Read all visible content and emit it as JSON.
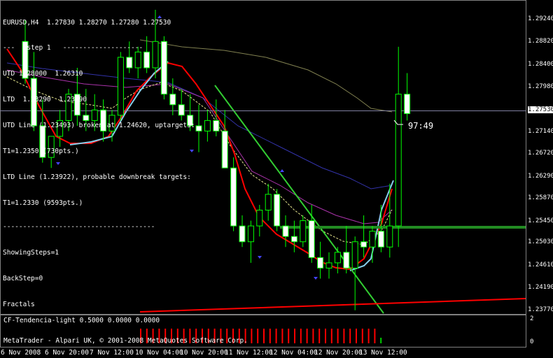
{
  "header": {
    "symbol_line": "EURUSD,H4  1.27830 1.28270 1.27280 1.27530",
    "info_lines": [
      "---   step 1   --------------------",
      "UTD 1.28000  1.26310",
      "LTD  1.23290  1.23890",
      "UTD Line (1.23493) broken at 1.24620, uptargets:",
      "T1=1.2350 (730pts.)",
      "LTD Line (1.23922), probable downbreak targets:",
      "T1=1.2330 (9593pts.)",
      "--------------------------------------",
      "ShowingSteps=1",
      "BackStep=0",
      "Fractals"
    ]
  },
  "timer": "97:49",
  "indicator": {
    "title": "CF-Tendencia-light 0.5000 0.0000 0.0000",
    "scale": [
      "2",
      "0"
    ]
  },
  "footer": {
    "copyright": "MetaTrader - Alpari UK, © 2001-2008 MetaQuotes Software Corp."
  },
  "price_axis": {
    "labels": [
      "1.29240",
      "1.28820",
      "1.28400",
      "1.27980",
      "1.27530",
      "1.27140",
      "1.26720",
      "1.26290",
      "1.25870",
      "1.25450",
      "1.25030",
      "1.24610",
      "1.24190",
      "1.23770"
    ],
    "current": "1.27530"
  },
  "time_axis": [
    "6 Nov 2008",
    "6 Nov 20:00",
    "7 Nov 12:00",
    "10 Nov 04:00",
    "10 Nov 20:00",
    "11 Nov 12:00",
    "12 Nov 04:00",
    "12 Nov 20:00",
    "13 Nov 12:00"
  ],
  "colors": {
    "bull": "#00ff00",
    "bear": "#00ff00",
    "bull_body": "#000000",
    "bear_body": "#ffffff",
    "red_line": "#ff0000",
    "light_blue": "#87ceeb",
    "trend_green": "#32cd32",
    "indicator_bar": "#ff0000"
  },
  "chart_data": {
    "type": "candlestick",
    "price_range": [
      1.2377,
      1.2966
    ],
    "candles": [
      {
        "o": 1.289,
        "h": 1.293,
        "l": 1.281,
        "c": 1.282
      },
      {
        "o": 1.282,
        "h": 1.287,
        "l": 1.272,
        "c": 1.273
      },
      {
        "o": 1.273,
        "h": 1.278,
        "l": 1.266,
        "c": 1.267
      },
      {
        "o": 1.267,
        "h": 1.271,
        "l": 1.265,
        "c": 1.271
      },
      {
        "o": 1.271,
        "h": 1.276,
        "l": 1.269,
        "c": 1.274
      },
      {
        "o": 1.274,
        "h": 1.28,
        "l": 1.272,
        "c": 1.279
      },
      {
        "o": 1.279,
        "h": 1.284,
        "l": 1.273,
        "c": 1.275
      },
      {
        "o": 1.275,
        "h": 1.28,
        "l": 1.272,
        "c": 1.274
      },
      {
        "o": 1.274,
        "h": 1.279,
        "l": 1.272,
        "c": 1.276
      },
      {
        "o": 1.276,
        "h": 1.278,
        "l": 1.27,
        "c": 1.272
      },
      {
        "o": 1.272,
        "h": 1.276,
        "l": 1.27,
        "c": 1.275
      },
      {
        "o": 1.275,
        "h": 1.287,
        "l": 1.274,
        "c": 1.286
      },
      {
        "o": 1.286,
        "h": 1.289,
        "l": 1.283,
        "c": 1.284
      },
      {
        "o": 1.284,
        "h": 1.288,
        "l": 1.282,
        "c": 1.287
      },
      {
        "o": 1.287,
        "h": 1.29,
        "l": 1.283,
        "c": 1.284
      },
      {
        "o": 1.284,
        "h": 1.295,
        "l": 1.282,
        "c": 1.289
      },
      {
        "o": 1.289,
        "h": 1.29,
        "l": 1.278,
        "c": 1.279
      },
      {
        "o": 1.279,
        "h": 1.282,
        "l": 1.275,
        "c": 1.277
      },
      {
        "o": 1.277,
        "h": 1.28,
        "l": 1.274,
        "c": 1.275
      },
      {
        "o": 1.275,
        "h": 1.279,
        "l": 1.272,
        "c": 1.273
      },
      {
        "o": 1.273,
        "h": 1.277,
        "l": 1.268,
        "c": 1.272
      },
      {
        "o": 1.272,
        "h": 1.276,
        "l": 1.27,
        "c": 1.274
      },
      {
        "o": 1.274,
        "h": 1.278,
        "l": 1.271,
        "c": 1.272
      },
      {
        "o": 1.272,
        "h": 1.276,
        "l": 1.265,
        "c": 1.265
      },
      {
        "o": 1.265,
        "h": 1.267,
        "l": 1.253,
        "c": 1.254
      },
      {
        "o": 1.254,
        "h": 1.256,
        "l": 1.25,
        "c": 1.251
      },
      {
        "o": 1.251,
        "h": 1.255,
        "l": 1.247,
        "c": 1.254
      },
      {
        "o": 1.254,
        "h": 1.258,
        "l": 1.252,
        "c": 1.257
      },
      {
        "o": 1.257,
        "h": 1.262,
        "l": 1.255,
        "c": 1.26
      },
      {
        "o": 1.26,
        "h": 1.261,
        "l": 1.253,
        "c": 1.254
      },
      {
        "o": 1.254,
        "h": 1.256,
        "l": 1.25,
        "c": 1.252
      },
      {
        "o": 1.252,
        "h": 1.255,
        "l": 1.249,
        "c": 1.251
      },
      {
        "o": 1.251,
        "h": 1.256,
        "l": 1.25,
        "c": 1.255
      },
      {
        "o": 1.255,
        "h": 1.258,
        "l": 1.247,
        "c": 1.248
      },
      {
        "o": 1.248,
        "h": 1.251,
        "l": 1.244,
        "c": 1.246
      },
      {
        "o": 1.246,
        "h": 1.249,
        "l": 1.244,
        "c": 1.247
      },
      {
        "o": 1.247,
        "h": 1.25,
        "l": 1.245,
        "c": 1.249
      },
      {
        "o": 1.249,
        "h": 1.254,
        "l": 1.245,
        "c": 1.246
      },
      {
        "o": 1.246,
        "h": 1.252,
        "l": 1.238,
        "c": 1.251
      },
      {
        "o": 1.251,
        "h": 1.256,
        "l": 1.248,
        "c": 1.25
      },
      {
        "o": 1.25,
        "h": 1.254,
        "l": 1.247,
        "c": 1.253
      },
      {
        "o": 1.253,
        "h": 1.258,
        "l": 1.249,
        "c": 1.25
      },
      {
        "o": 1.25,
        "h": 1.262,
        "l": 1.248,
        "c": 1.254
      },
      {
        "o": 1.254,
        "h": 1.288,
        "l": 1.25,
        "c": 1.279
      },
      {
        "o": 1.279,
        "h": 1.283,
        "l": 1.274,
        "c": 1.2753
      }
    ]
  }
}
